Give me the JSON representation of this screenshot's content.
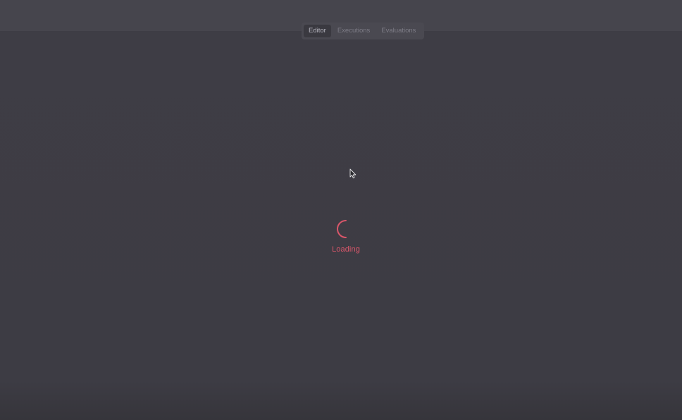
{
  "tabs": [
    {
      "label": "Editor",
      "active": true
    },
    {
      "label": "Executions",
      "active": false
    },
    {
      "label": "Evaluations",
      "active": false
    }
  ],
  "loader": {
    "text": "Loading",
    "color": "#d9566a"
  },
  "icons": {
    "cursor": "mouse-pointer-icon",
    "spinner": "loading-spinner-icon"
  }
}
